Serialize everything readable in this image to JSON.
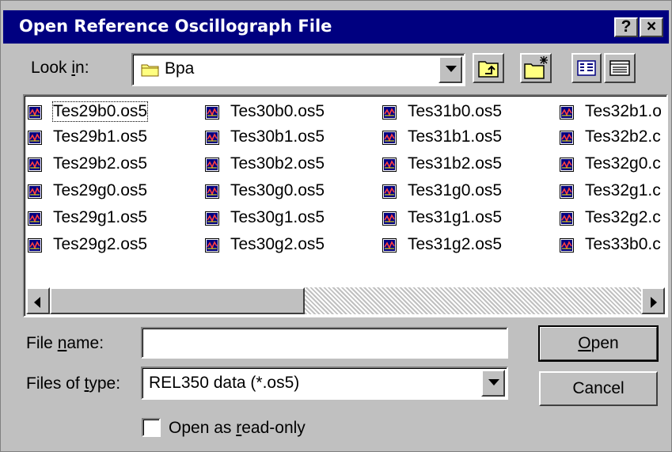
{
  "window": {
    "title": "Open Reference Oscillograph File",
    "help_glyph": "?",
    "close_glyph": "×"
  },
  "look_in": {
    "label_pre": "Look ",
    "label_key": "i",
    "label_post": "n:",
    "folder_icon": "folder-icon",
    "value": "Bpa"
  },
  "toolbar": {
    "icons": [
      "up-one-level-icon",
      "create-new-folder-icon",
      "list-view-icon",
      "details-view-icon"
    ]
  },
  "files": {
    "icon": "oscillograph-file-icon",
    "columns": [
      [
        "Tes29b0.os5",
        "Tes29b1.os5",
        "Tes29b2.os5",
        "Tes29g0.os5",
        "Tes29g1.os5",
        "Tes29g2.os5"
      ],
      [
        "Tes30b0.os5",
        "Tes30b1.os5",
        "Tes30b2.os5",
        "Tes30g0.os5",
        "Tes30g1.os5",
        "Tes30g2.os5"
      ],
      [
        "Tes31b0.os5",
        "Tes31b1.os5",
        "Tes31b2.os5",
        "Tes31g0.os5",
        "Tes31g1.os5",
        "Tes31g2.os5"
      ],
      [
        "Tes32b1.o",
        "Tes32b2.c",
        "Tes32g0.c",
        "Tes32g1.c",
        "Tes32g2.c",
        "Tes33b0.c"
      ]
    ],
    "focused": "Tes29b0.os5",
    "scroll_position": 0.0
  },
  "file_name": {
    "label_pre": "File ",
    "label_key": "n",
    "label_post": "ame:",
    "value": ""
  },
  "file_type": {
    "label_pre": "Files of ",
    "label_key": "t",
    "label_post": "ype:",
    "value": "REL350 data (*.os5)"
  },
  "buttons": {
    "open_key": "O",
    "open_rest": "pen",
    "cancel": "Cancel"
  },
  "readonly": {
    "label_pre": "Open as ",
    "label_key": "r",
    "label_post": "ead-only",
    "checked": false
  },
  "colors": {
    "titlebar": "#000080",
    "face": "#c0c0c0"
  }
}
